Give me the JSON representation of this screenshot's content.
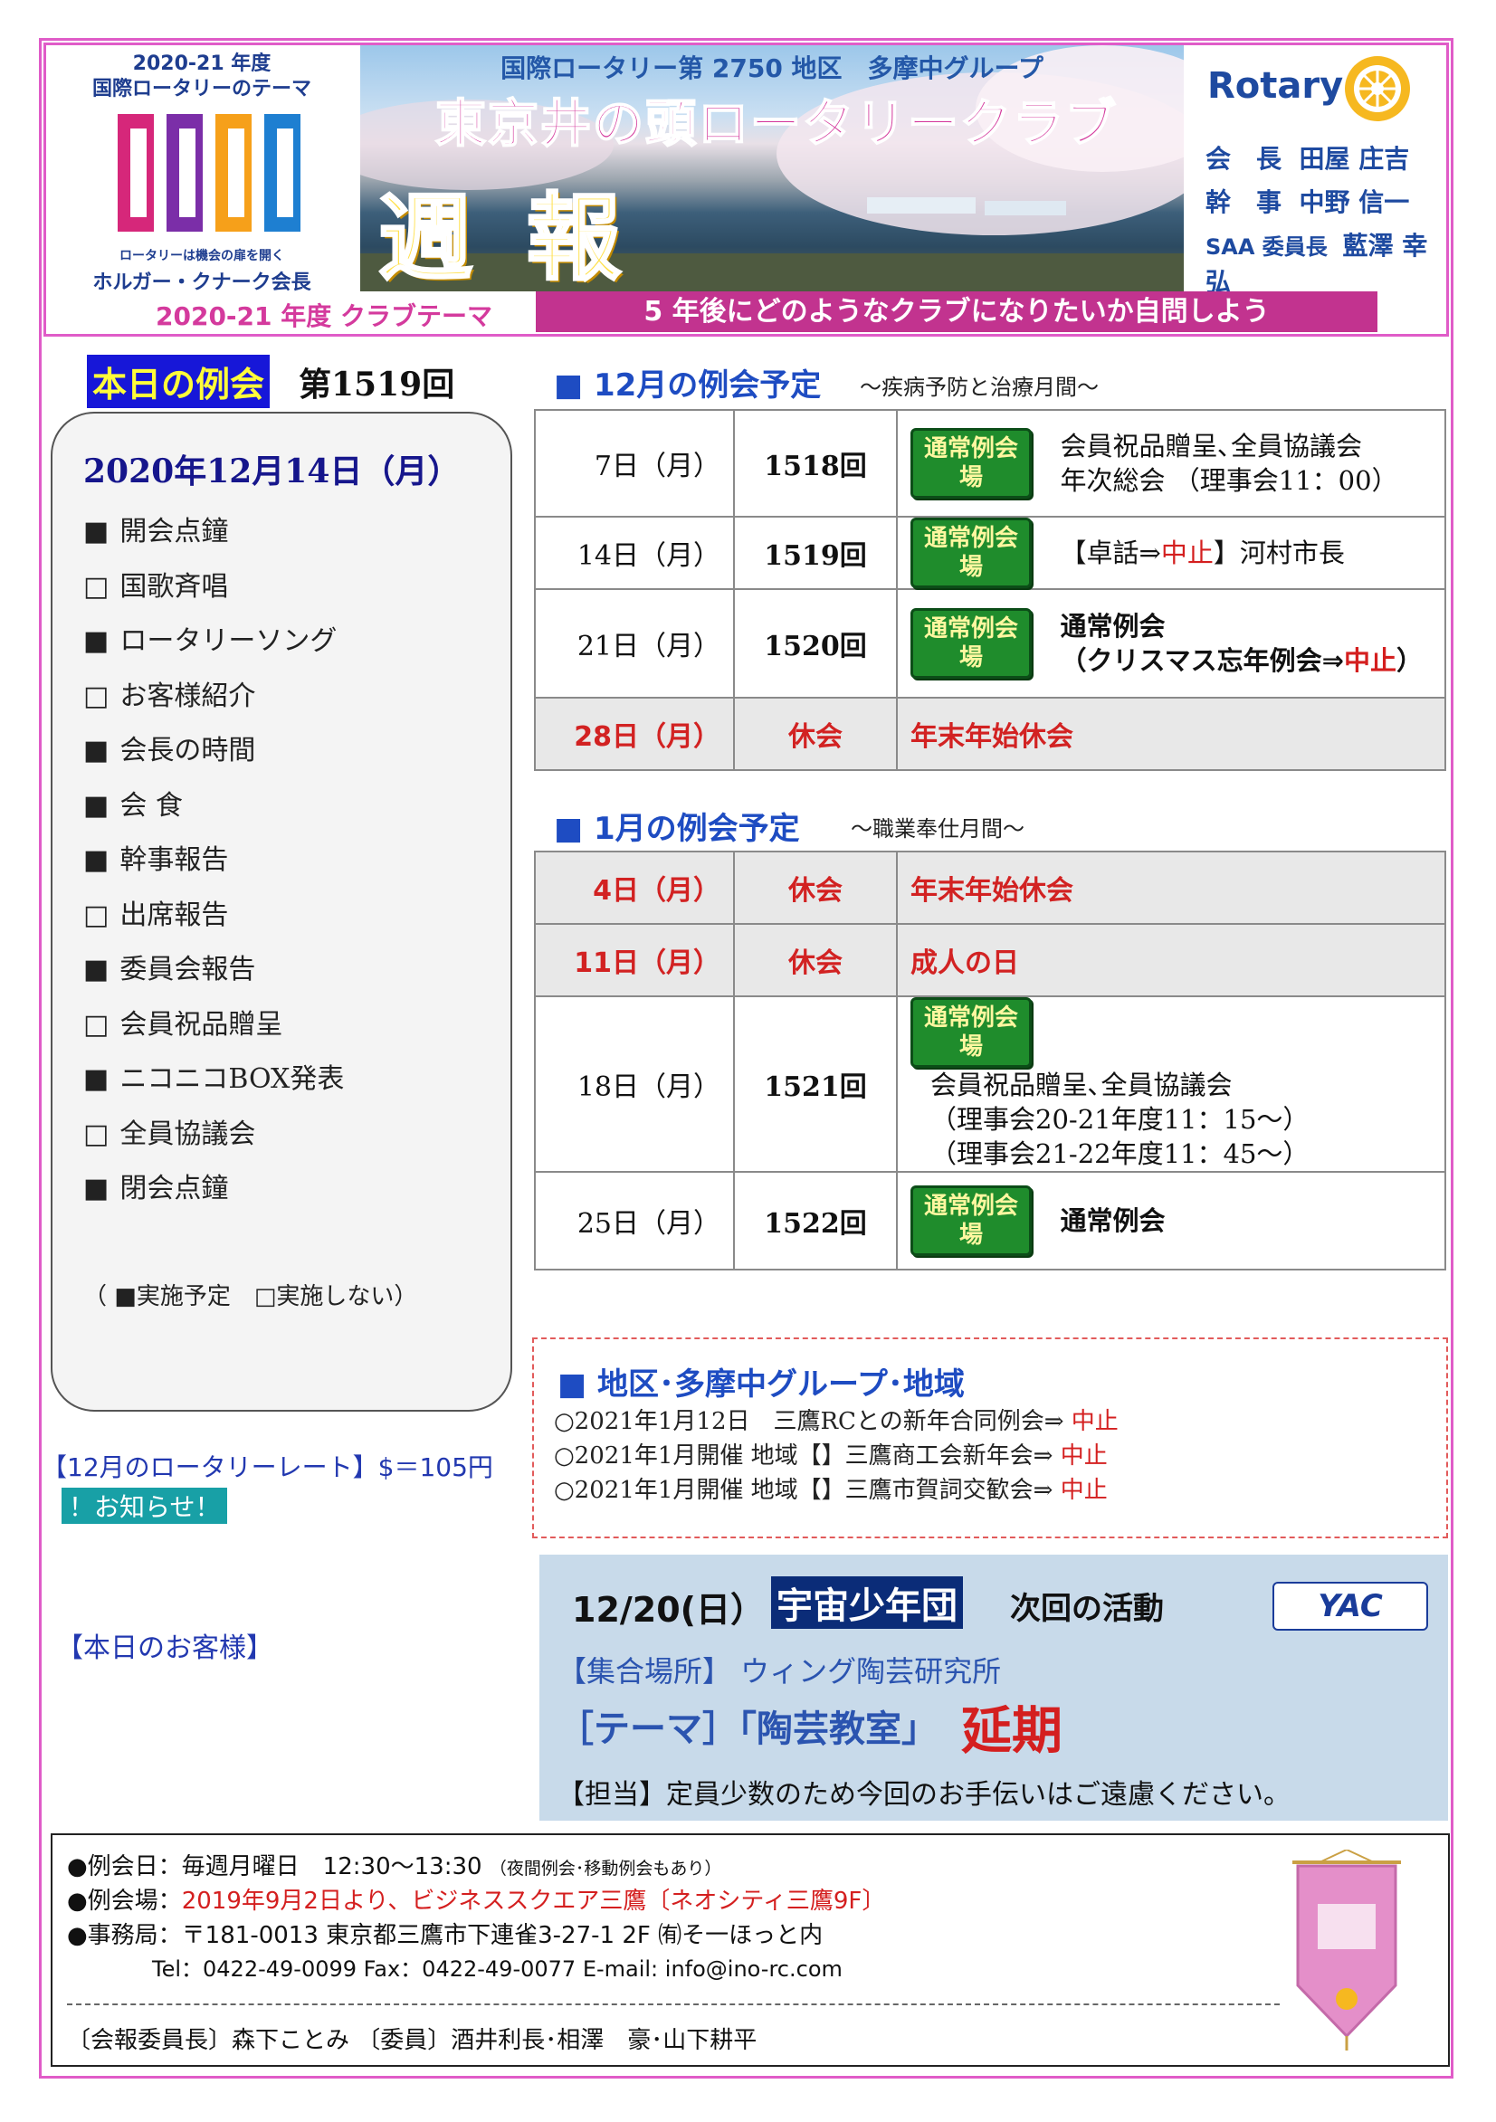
{
  "header": {
    "theme_year": "2020-21 年度",
    "theme_title": "国際ロータリーのテーマ",
    "theme_small": "ロータリーは機会の扉を開く",
    "theme_president": "ホルガー・クナーク会長",
    "district": "国際ロータリー第 2750 地区　多摩中グループ",
    "club_name": "東京井の頭ロータリークラブ",
    "weekly": "週報",
    "rotary_word": "Rotary",
    "officers": [
      {
        "role": "会　長",
        "name": "田屋 庄吉"
      },
      {
        "role": "幹　事",
        "name": "中野 信一"
      },
      {
        "role": "SAA 委員長",
        "name": "藍澤 幸弘"
      }
    ],
    "club_theme_label": "2020-21 年度 クラブテーマ",
    "club_theme_text": "5 年後にどのようなクラブになりたいか自問しよう"
  },
  "today": {
    "label": "本日の例会",
    "number": "第1519回",
    "date": "2020年12月14日（月）",
    "items": [
      {
        "mark": "■",
        "text": "開会点鐘"
      },
      {
        "mark": "□",
        "text": "国歌斉唱"
      },
      {
        "mark": "■",
        "text": "ロータリーソング"
      },
      {
        "mark": "□",
        "text": "お客様紹介"
      },
      {
        "mark": "■",
        "text": "会長の時間"
      },
      {
        "mark": "■",
        "text": "会 食"
      },
      {
        "mark": "■",
        "text": "幹事報告"
      },
      {
        "mark": "□",
        "text": "出席報告"
      },
      {
        "mark": "■",
        "text": "委員会報告"
      },
      {
        "mark": "□",
        "text": "会員祝品贈呈"
      },
      {
        "mark": "■",
        "text": "ニコニコBOX発表"
      },
      {
        "mark": "□",
        "text": "全員協議会"
      },
      {
        "mark": "■",
        "text": "閉会点鐘"
      }
    ],
    "legend": "（ ■実施予定　□実施しない）",
    "rate": "【12月のロータリーレート】$＝105円",
    "notice": "！お知らせ！",
    "guests": "【本日のお客様】"
  },
  "december": {
    "title": "■ 12月の例会予定",
    "subtitle": "～疾病予防と治療月間～",
    "rows": [
      {
        "date": "7日（月）",
        "num": "1518回",
        "badge": "通常例会場",
        "desc1": "会員祝品贈呈､全員協議会",
        "desc2": "年次総会 （理事会11：00）"
      },
      {
        "date": "14日（月）",
        "num": "1519回",
        "badge": "通常例会場",
        "desc_pre": "【卓話⇒",
        "desc_red": "中止",
        "desc_post": "】河村市長"
      },
      {
        "date": "21日（月）",
        "num": "1520回",
        "badge": "通常例会場",
        "desc1": "通常例会",
        "desc_pre": "（クリスマス忘年例会⇒",
        "desc_red": "中止",
        "desc_post": "）"
      },
      {
        "date": "28日（月）",
        "num": "休会",
        "desc": "年末年始休会"
      }
    ]
  },
  "january": {
    "title": "■ 1月の例会予定",
    "subtitle": "～職業奉仕月間～",
    "rows": [
      {
        "date": "4日（月）",
        "num": "休会",
        "desc": "年末年始休会"
      },
      {
        "date": "11日（月）",
        "num": "休会",
        "desc": "成人の日"
      },
      {
        "date": "18日（月）",
        "num": "1521回",
        "badge": "通常例会場",
        "desc1": "会員祝品贈呈､全員協議会",
        "desc2": "（理事会20-21年度11：15～）",
        "desc3": "（理事会21-22年度11：45～）"
      },
      {
        "date": "25日（月）",
        "num": "1522回",
        "badge": "通常例会場",
        "desc1": "通常例会"
      }
    ]
  },
  "region": {
    "title": "■ 地区･多摩中グループ･地域",
    "items": [
      {
        "text": "○2021年1月12日　三鷹RCとの新年合同例会⇒ ",
        "status": "中止"
      },
      {
        "text": "○2021年1月開催 地域【】三鷹商工会新年会⇒ ",
        "status": "中止"
      },
      {
        "text": "○2021年1月開催 地域【】三鷹市賀詞交歓会⇒ ",
        "status": "中止"
      }
    ]
  },
  "space": {
    "date": "12/20(日）",
    "name": "宇宙少年団",
    "next": "次回の活動",
    "logo": "YAC",
    "place": "【集合場所】 ウィング陶芸研究所",
    "theme": "［テーマ］「陶芸教室」",
    "postponed": "延期",
    "charge": "【担当】定員少数のため今回のお手伝いはご遠慮ください。"
  },
  "footer": {
    "day": "●例会日：毎週月曜日　12:30～13:30",
    "day_note": "（夜間例会･移動例会もあり）",
    "venue_label": "●例会場：",
    "venue": "2019年9月2日より、ビジネススクエア三鷹〔ネオシティ三鷹9F〕",
    "office": "●事務局：〒181-0013 東京都三鷹市下連雀3-27-1 2F ㈲そ一ほっと内",
    "contact": "Tel：0422-49-0099 Fax：0422-49-0077 E-mail: info@ino-rc.com",
    "editors": "〔会報委員長〕森下ことみ 〔委員〕酒井利長･相澤　豪･山下耕平"
  },
  "colors": {
    "accent_pink": "#e05cc8",
    "title_blue": "#1e4cc2",
    "red": "#d41f1f",
    "badge_green": "#1f8c2c"
  }
}
